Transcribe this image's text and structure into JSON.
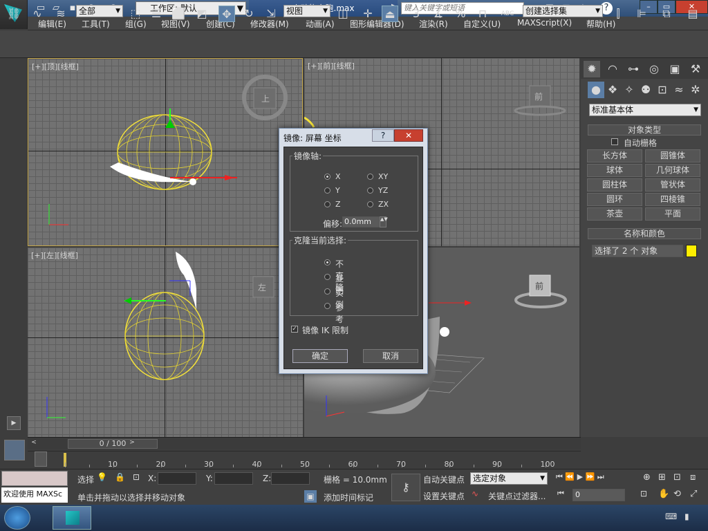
{
  "titlebar": {
    "document_title": "小动物奔跑.max",
    "workspace": "工作区: 默认",
    "search_placeholder": "键入关键字或短语"
  },
  "menubar": [
    "编辑(E)",
    "工具(T)",
    "组(G)",
    "视图(V)",
    "创建(C)",
    "修改器(M)",
    "动画(A)",
    "图形编辑器(D)",
    "渲染(R)",
    "自定义(U)",
    "MAXScript(X)",
    "帮助(H)"
  ],
  "toolbar": {
    "selection_filter": "全部",
    "ref_coord": "视图",
    "named_selection": "创建选择集",
    "snap_3": "3",
    "abc": "ABC"
  },
  "viewports": {
    "top": "[+][顶][线框]",
    "front": "[+][前][线框]",
    "left": "[+][左][线框]",
    "viewcube_top": "上",
    "viewcube_front": "前",
    "viewcube_left": "左",
    "viewcube_persp": "前"
  },
  "command_panel": {
    "category": "标准基本体",
    "object_type_header": "对象类型",
    "autogrid": "自动栅格",
    "objects": [
      "长方体",
      "圆锥体",
      "球体",
      "几何球体",
      "圆柱体",
      "管状体",
      "圆环",
      "四棱锥",
      "茶壶",
      "平面"
    ],
    "name_color_header": "名称和颜色",
    "name_value": "选择了 2 个 对象",
    "color": "#ffee00"
  },
  "dialog": {
    "title": "镜像: 屏幕 坐标",
    "axis_group": "镜像轴:",
    "axes": [
      "X",
      "Y",
      "Z",
      "XY",
      "YZ",
      "ZX"
    ],
    "offset_label": "偏移:",
    "offset_value": "0.0mm",
    "clone_group": "克隆当前选择:",
    "clone_options": [
      "不克隆",
      "复制",
      "实例",
      "参考"
    ],
    "mirror_ik": "镜像 IK 限制",
    "ok": "确定",
    "cancel": "取消"
  },
  "timeline": {
    "frame_display": "0 / 100",
    "ticks": [
      "10",
      "20",
      "30",
      "40",
      "50",
      "60",
      "70",
      "80",
      "90",
      "100"
    ]
  },
  "status": {
    "welcome": "欢迎使用 MAXSc",
    "select_label": "选择",
    "x_label": "X:",
    "y_label": "Y:",
    "z_label": "Z:",
    "grid": "栅格 = 10.0mm",
    "prompt": "单击并拖动以选择并移动对象",
    "add_time_tag": "添加时间标记",
    "auto_key": "自动关键点",
    "set_key": "设置关键点",
    "selected_objects": "选定对象",
    "key_filters": "关键点过滤器...",
    "frame_value": "0"
  }
}
